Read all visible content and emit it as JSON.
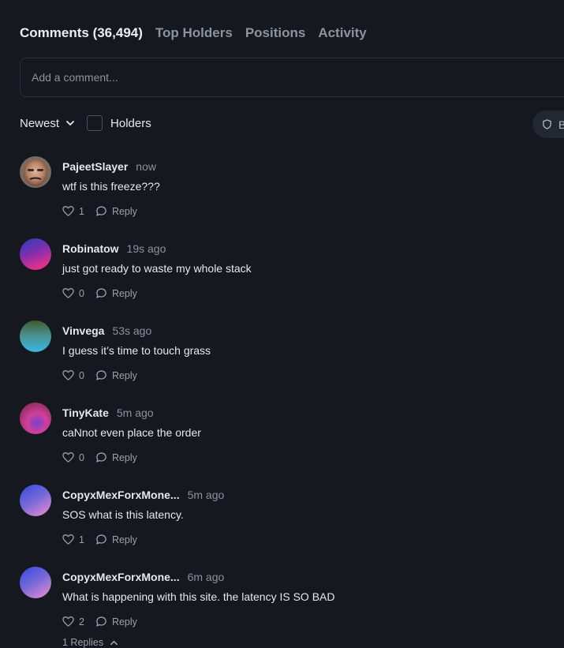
{
  "tabs": [
    {
      "label": "Comments (36,494)",
      "active": true
    },
    {
      "label": "Top Holders",
      "active": false
    },
    {
      "label": "Positions",
      "active": false
    },
    {
      "label": "Activity",
      "active": false
    }
  ],
  "comment_input": {
    "placeholder": "Add a comment..."
  },
  "filters": {
    "sort_label": "Newest",
    "sort_icon": "chevron-down-icon",
    "holders_label": "Holders",
    "holders_checked": false
  },
  "pill": {
    "icon": "shield-icon",
    "label": "B"
  },
  "comments": [
    {
      "username": "PajeetSlayer",
      "time": "now",
      "text": "wtf is this freeze???",
      "likes": "1",
      "reply_label": "Reply"
    },
    {
      "username": "Robinatow",
      "time": "19s ago",
      "text": "just got ready to waste my whole stack",
      "likes": "0",
      "reply_label": "Reply"
    },
    {
      "username": "Vinvega",
      "time": "53s ago",
      "text": "I guess it’s time to touch grass",
      "likes": "0",
      "reply_label": "Reply"
    },
    {
      "username": "TinyKate",
      "time": "5m ago",
      "text": "caNnot even place the order",
      "likes": "0",
      "reply_label": "Reply"
    },
    {
      "username": "CopyxMexForxMone...",
      "time": "5m ago",
      "text": "SOS what is this latency.",
      "likes": "1",
      "reply_label": "Reply"
    },
    {
      "username": "CopyxMexForxMone...",
      "time": "6m ago",
      "text": "What is happening with this site. the latency IS SO BAD",
      "likes": "2",
      "reply_label": "Reply"
    }
  ],
  "replies_toggle": {
    "label": "1 Replies",
    "icon": "chevron-up-icon"
  },
  "colors": {
    "background": "#15181e",
    "text_primary": "#e6e8ec",
    "text_muted": "#8b93a1",
    "border": "#2b303a"
  }
}
